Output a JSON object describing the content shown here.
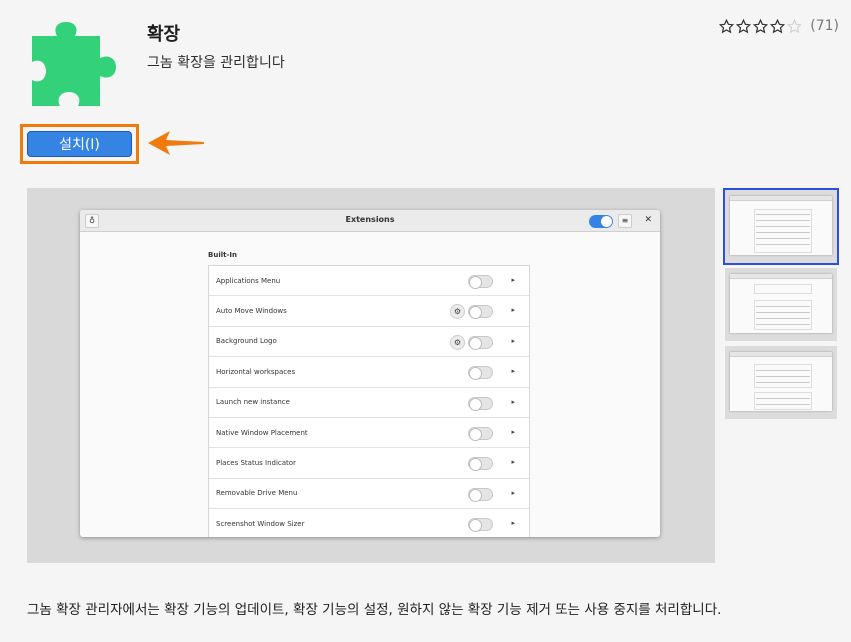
{
  "app": {
    "title": "확장",
    "summary": "그놈 확장을 관리합니다",
    "icon": "puzzle-piece-icon",
    "icon_color": "#33d17a"
  },
  "rating": {
    "stars_filled": 4,
    "stars_total": 5,
    "count": "(71)"
  },
  "install": {
    "label": "설치(I)",
    "color": "#3584e4",
    "highlight_color": "#f07a0c"
  },
  "screenshot": {
    "window_title": "Extensions",
    "section": "Built-In",
    "items": [
      {
        "label": "Applications Menu",
        "settings": false
      },
      {
        "label": "Auto Move Windows",
        "settings": true
      },
      {
        "label": "Background Logo",
        "settings": true
      },
      {
        "label": "Horizontal workspaces",
        "settings": false
      },
      {
        "label": "Launch new instance",
        "settings": false
      },
      {
        "label": "Native Window Placement",
        "settings": false
      },
      {
        "label": "Places Status Indicator",
        "settings": false
      },
      {
        "label": "Removable Drive Menu",
        "settings": false
      },
      {
        "label": "Screenshot Window Sizer",
        "settings": false
      }
    ]
  },
  "thumbnails": {
    "count": 3,
    "selected_index": 0
  },
  "description": "그놈 확장 관리자에서는 확장 기능의 업데이트, 확장 기능의 설정, 원하지 않는 확장 기능 제거 또는 사용 중지를 처리합니다."
}
